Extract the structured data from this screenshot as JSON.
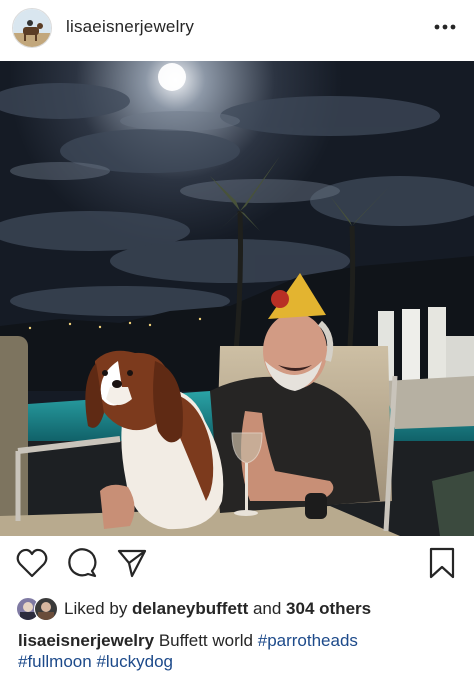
{
  "post": {
    "username": "lisaeisnerjewelry",
    "more_icon": "ellipsis-icon"
  },
  "actions": {
    "like_icon": "heart-icon",
    "comment_icon": "comment-icon",
    "share_icon": "paper-plane-icon",
    "save_icon": "bookmark-icon"
  },
  "likes": {
    "prefix": "Liked by ",
    "user": "delaneybuffett",
    "and": " and ",
    "others": "304 others"
  },
  "caption": {
    "username": "lisaeisnerjewelry",
    "text": " Buffett world ",
    "tag1": "#parrotheads",
    "tag2": "#fullmoon",
    "tag3": "#luckydog"
  }
}
